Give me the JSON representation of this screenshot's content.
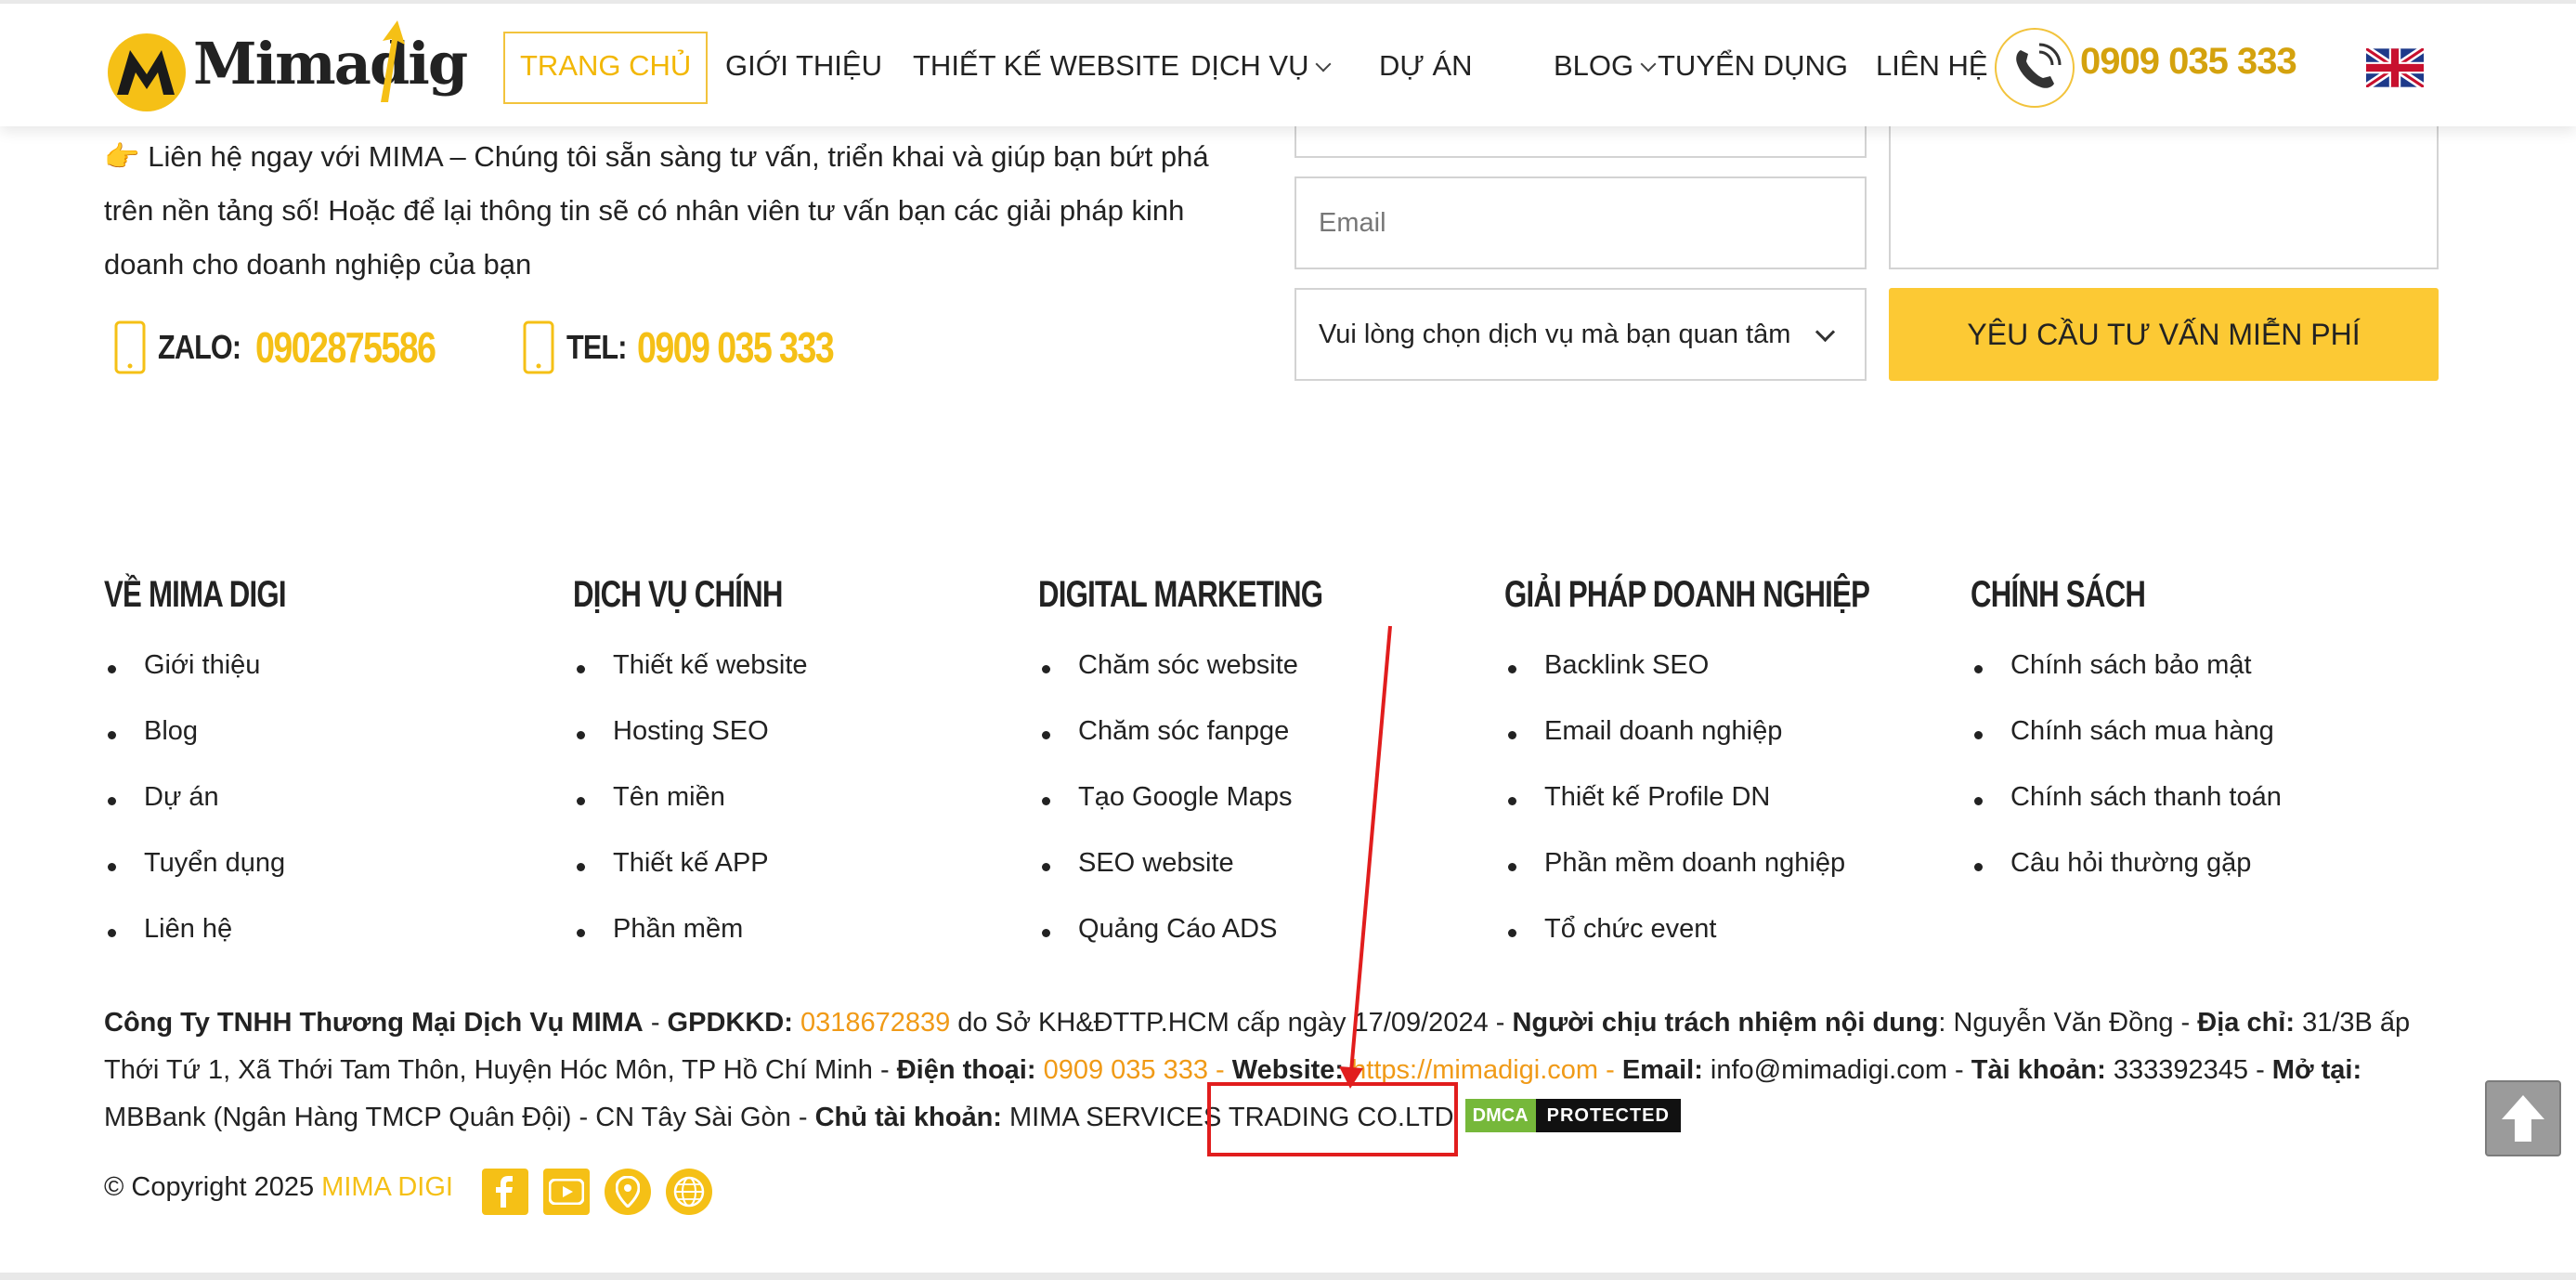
{
  "header": {
    "logo_text": "Mimadig",
    "nav": [
      {
        "label": "TRANG CHỦ"
      },
      {
        "label": "GIỚI THIỆU"
      },
      {
        "label": "THIẾT KẾ WEBSITE"
      },
      {
        "label": "DỊCH VỤ"
      },
      {
        "label": "DỰ ÁN"
      },
      {
        "label": "BLOG"
      },
      {
        "label": "TUYỂN DỤNG"
      },
      {
        "label": "LIÊN HỆ"
      }
    ],
    "hotline": "0909 035 333"
  },
  "contact": {
    "intro_emoji": "👉",
    "intro": "Liên hệ ngay với MIMA – Chúng tôi sẵn sàng tư vấn, triển khai và giúp bạn bứt phá trên nền tảng số! Hoặc để lại thông tin sẽ có nhân viên tư vấn bạn các giải pháp kinh doanh cho doanh nghiệp của bạn",
    "zalo_label": "ZALO:",
    "zalo_value": "0902875586",
    "tel_label": "TEL:",
    "tel_value": "0909 035 333"
  },
  "form": {
    "email_placeholder": "Email",
    "service_select_value": "Vui lòng chọn dịch vụ mà bạn quan tâm",
    "submit_label": "YÊU CẦU TƯ VẤN MIỄN PHÍ"
  },
  "footer_columns": [
    {
      "title": "VỀ MIMA DIGI",
      "items": [
        "Giới thiệu",
        "Blog",
        "Dự án",
        "Tuyển dụng",
        "Liên hệ"
      ]
    },
    {
      "title": "DỊCH VỤ CHÍNH",
      "items": [
        "Thiết kế website",
        "Hosting SEO",
        "Tên miền",
        "Thiết kế APP",
        "Phần mềm"
      ]
    },
    {
      "title": "DIGITAL MARKETING",
      "items": [
        "Chăm sóc website",
        "Chăm sóc fanpge",
        "Tạo Google Maps",
        "SEO website",
        "Quảng Cáo ADS"
      ]
    },
    {
      "title": "GIẢI PHÁP DOANH NGHIỆP",
      "items": [
        "Backlink SEO",
        "Email doanh nghiệp",
        "Thiết kế Profile DN",
        "Phần mềm doanh nghiệp",
        "Tổ chức event"
      ]
    },
    {
      "title": "CHÍNH SÁCH",
      "items": [
        "Chính sách bảo mật",
        "Chính sách mua hàng",
        "Chính sách thanh toán",
        "Câu hỏi thường gặp"
      ]
    }
  ],
  "company": {
    "name": "Công Ty TNHH Thương Mại Dịch Vụ MIMA",
    "sep1": " - ",
    "gpdkkd_label": "GPDKKD:",
    "gpdkkd_value": "0318672839",
    "gpdkkd_note": " do Sở KH&ĐTTP.HCM cấp ngày 17/09/2024 - ",
    "responsible_label": "Người chịu trách nhiệm nội dung",
    "responsible_value": ": Nguyễn Văn Đồng - ",
    "address_label": "Địa chỉ:",
    "address_value": " 31/3B ấp Thới Tứ 1, Xã Thới Tam Thôn, Huyện Hóc Môn, TP Hồ Chí Minh - ",
    "phone_label": "Điện thoại:",
    "phone_value": " 0909 035 333 - ",
    "website_label": "Website:",
    "website_value": " https://mimadigi.com - ",
    "email_label": "Email:",
    "email_value": " info@mimadigi.com - ",
    "account_label": "Tài khoản:",
    "account_value": " 333392345 - ",
    "bank_label": "Mở tại:",
    "bank_value": " MBBank (Ngân Hàng TMCP Quân Đội) - CN Tây Sài Gòn - ",
    "owner_label": "Chủ tài khoản:",
    "owner_value": " MIMA SERVICES TRADING CO.LTD",
    "dmca_left": "DMCA",
    "dmca_right": "PROTECTED"
  },
  "copyright": {
    "text": "© Copyright 2025 ",
    "brand": "MIMA DIGI"
  },
  "colors": {
    "accent": "#f5c016",
    "orange": "#f09a17",
    "annotation": "#e11d1d"
  },
  "icons": [
    "phone-icon",
    "flag-uk-icon",
    "mobile-icon",
    "facebook-icon",
    "youtube-icon",
    "location-icon",
    "globe-icon",
    "arrow-up-icon"
  ]
}
